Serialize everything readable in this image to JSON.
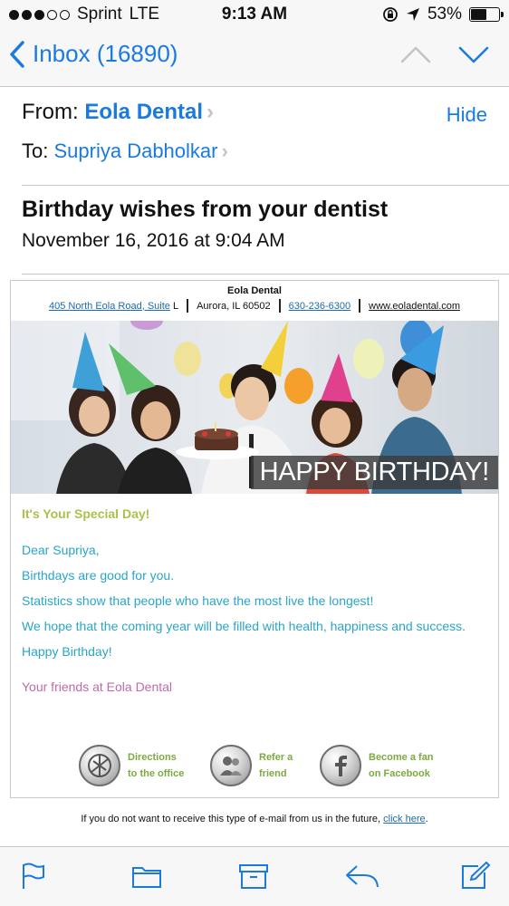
{
  "status_bar": {
    "carrier": "Sprint",
    "network": "LTE",
    "time": "9:13 AM",
    "battery": "53%",
    "battery_level": 0.53,
    "signal_bars": 3
  },
  "nav": {
    "back_label": "Inbox (16890)"
  },
  "header": {
    "from_label": "From:",
    "from_name": "Eola Dental",
    "hide_label": "Hide",
    "to_label": "To:",
    "to_name": "Supriya Dabholkar",
    "subject": "Birthday wishes from your dentist",
    "date": "November 16, 2016 at 9:04 AM"
  },
  "email": {
    "business_name": "Eola Dental",
    "address_link": "405 North Eola Road, Suite",
    "address_suffix": "L",
    "city": "Aurora, IL 60502",
    "phone": "630-236-6300",
    "website": "www.eoladental.com",
    "banner_text": "HAPPY BIRTHDAY!",
    "special_day": "It's Your Special Day!",
    "lines": [
      "Dear Supriya,",
      "Birthdays are good for you.",
      "Statistics show that people who have the most live the longest!",
      "We hope that the coming year will be filled with health, happiness and success.",
      "Happy Birthday!"
    ],
    "signature": "Your friends at Eola Dental",
    "actions": [
      {
        "line1": "Directions",
        "line2": "to the office",
        "icon": "map-icon"
      },
      {
        "line1": "Refer a",
        "line2": "friend",
        "icon": "friends-icon"
      },
      {
        "line1": "Become a fan",
        "line2": "on Facebook",
        "icon": "facebook-icon"
      }
    ],
    "unsubscribe_text": "If you do not want to receive this type of e-mail from us in the future,",
    "unsubscribe_link": "click here",
    "unsubscribe_end": "."
  },
  "toolbar": {
    "icons": [
      "flag-icon",
      "folder-icon",
      "archive-icon",
      "reply-icon",
      "compose-icon"
    ]
  },
  "colors": {
    "accent": "#1a7ae0",
    "green": "#a8c24a",
    "teal": "#2aa5c7",
    "pink": "#c06aa8"
  }
}
